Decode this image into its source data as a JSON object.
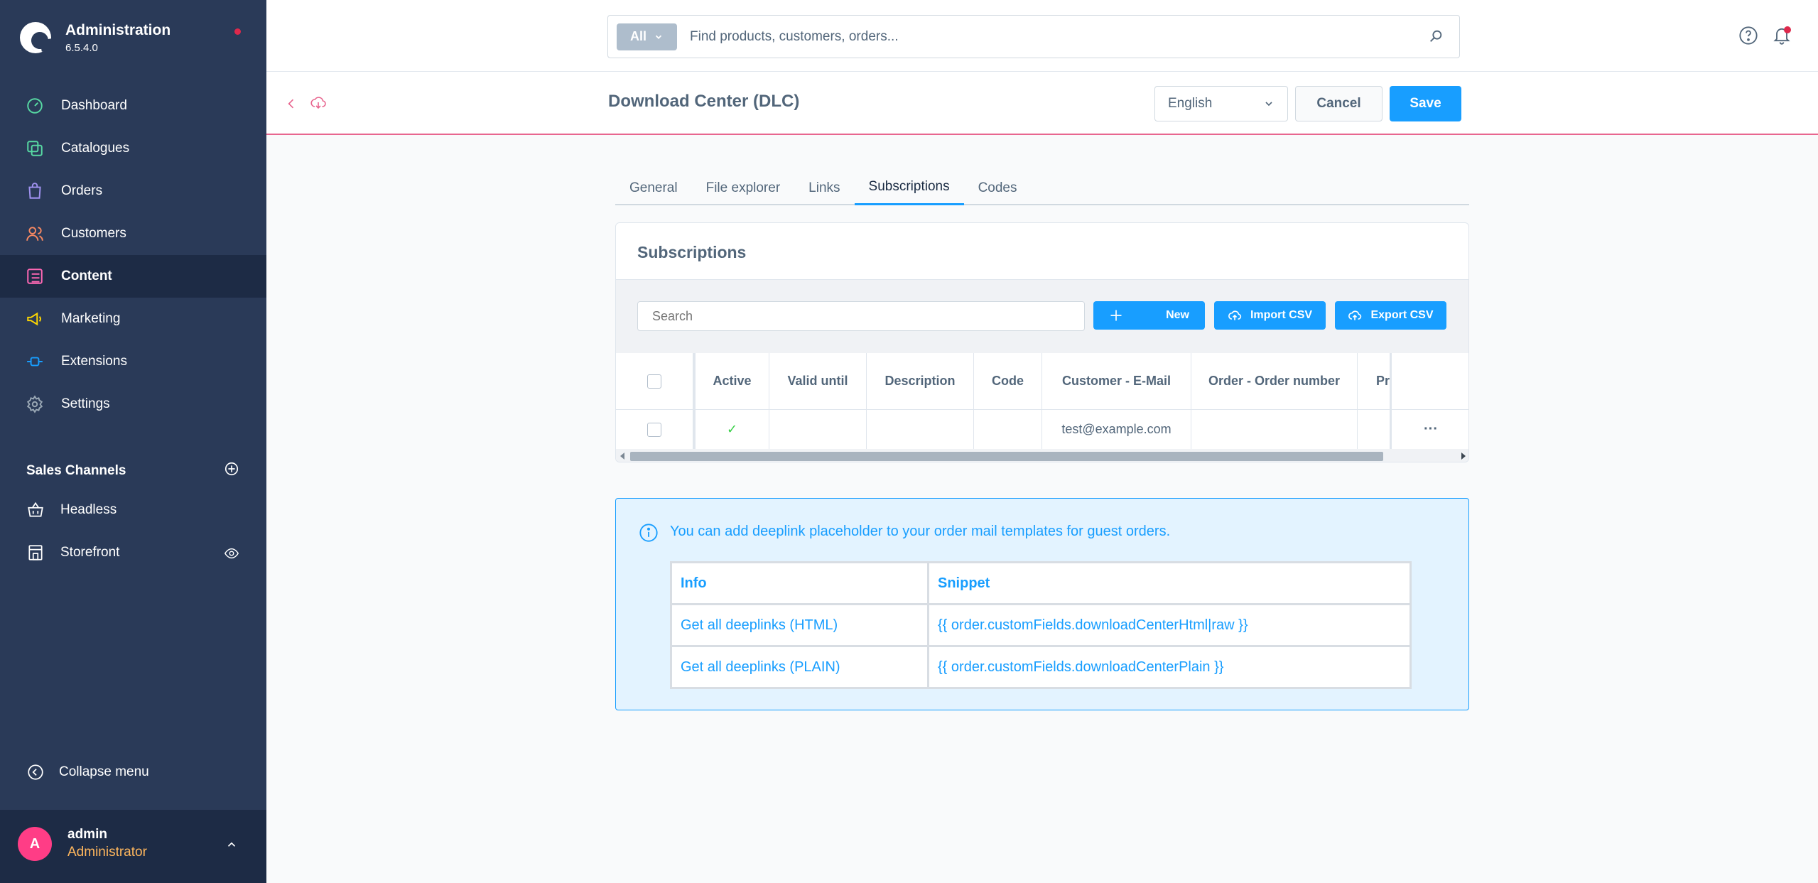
{
  "brand": {
    "title": "Administration",
    "version": "6.5.4.0"
  },
  "nav": [
    {
      "label": "Dashboard",
      "icon": "dashboard-icon",
      "color": "#57d9a3"
    },
    {
      "label": "Catalogues",
      "icon": "catalogue-icon",
      "color": "#57d9a3"
    },
    {
      "label": "Orders",
      "icon": "orders-icon",
      "color": "#a092f0"
    },
    {
      "label": "Customers",
      "icon": "customers-icon",
      "color": "#f88962"
    },
    {
      "label": "Content",
      "icon": "content-icon",
      "color": "#ff68b4"
    },
    {
      "label": "Marketing",
      "icon": "marketing-icon",
      "color": "#ffd700"
    },
    {
      "label": "Extensions",
      "icon": "extensions-icon",
      "color": "#189eff"
    },
    {
      "label": "Settings",
      "icon": "settings-icon",
      "color": "#9aa8b5"
    }
  ],
  "sales_channels": {
    "title": "Sales Channels",
    "items": [
      {
        "label": "Headless",
        "icon": "basket-icon"
      },
      {
        "label": "Storefront",
        "icon": "storefront-icon"
      }
    ]
  },
  "collapse_label": "Collapse menu",
  "user": {
    "initial": "A",
    "name": "admin",
    "role": "Administrator"
  },
  "search": {
    "chip": "All",
    "placeholder": "Find products, customers, orders..."
  },
  "smartbar": {
    "title": "Download Center (DLC)",
    "language": "English",
    "cancel": "Cancel",
    "save": "Save"
  },
  "tabs": [
    "General",
    "File explorer",
    "Links",
    "Subscriptions",
    "Codes"
  ],
  "card": {
    "title": "Subscriptions",
    "search_placeholder": "Search",
    "new_label": "New",
    "import_label": "Import CSV",
    "export_label": "Export CSV"
  },
  "grid": {
    "columns": [
      "Active",
      "Valid until",
      "Description",
      "Code",
      "Customer - E-Mail",
      "Order - Order number",
      "Pr"
    ],
    "rows": [
      {
        "active": "✓",
        "valid_until": "",
        "description": "",
        "code": "",
        "email": "test@example.com",
        "order_number": "",
        "pr": "",
        "actions": "···"
      }
    ]
  },
  "info": {
    "text": "You can add deeplink placeholder to your order mail templates for guest orders.",
    "headers": [
      "Info",
      "Snippet"
    ],
    "rows": [
      [
        "Get all deeplinks (HTML)",
        "{{ order.customFields.downloadCenterHtml|raw }}"
      ],
      [
        "Get all deeplinks (PLAIN)",
        "{{ order.customFields.downloadCenterPlain }}"
      ]
    ]
  },
  "colors": {
    "accent": "#189eff",
    "sidebar": "#2a3a58",
    "sidebar_active": "#1d2b45",
    "notification": "#de294c"
  }
}
